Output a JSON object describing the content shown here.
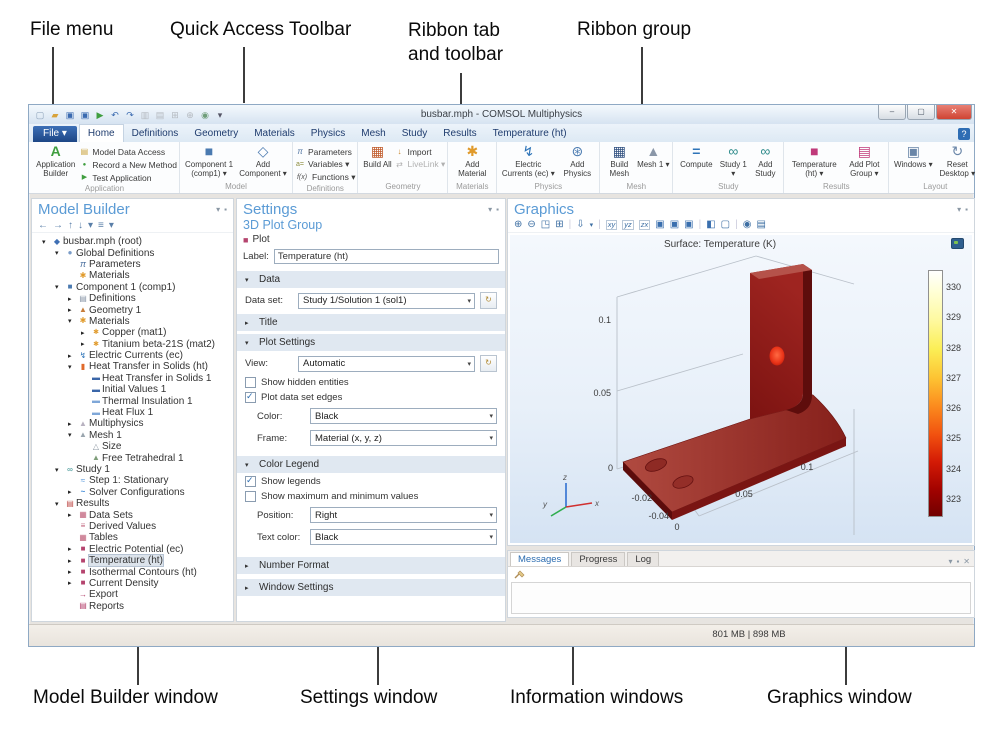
{
  "annotations": {
    "file_menu": "File menu",
    "quick_access": "Quick Access Toolbar",
    "ribbon_tab": "Ribbon tab and toolbar",
    "ribbon_group": "Ribbon group",
    "model_builder": "Model Builder window",
    "settings": "Settings window",
    "information": "Information windows",
    "graphics": "Graphics window"
  },
  "window": {
    "title": "busbar.mph - COMSOL Multiphysics",
    "file_button": "File ▾",
    "minimize_icon": "–",
    "maximize_icon": "▢",
    "close_icon": "✕",
    "help_icon": "?",
    "tabs": [
      {
        "label": "Home",
        "cls": "active",
        "name": "tab-home"
      },
      {
        "label": "Definitions",
        "name": "tab-definitions"
      },
      {
        "label": "Geometry",
        "name": "tab-geometry"
      },
      {
        "label": "Materials",
        "name": "tab-materials"
      },
      {
        "label": "Physics",
        "name": "tab-physics"
      },
      {
        "label": "Mesh",
        "name": "tab-mesh"
      },
      {
        "label": "Study",
        "name": "tab-study"
      },
      {
        "label": "Results",
        "name": "tab-results"
      },
      {
        "label": "Temperature (ht)",
        "name": "tab-temperature-ht"
      }
    ],
    "qat": [
      {
        "name": "new-file-icon",
        "glyph": "▢",
        "cls": "c-mid"
      },
      {
        "name": "open-file-icon",
        "glyph": "▰",
        "cls": "c-amber"
      },
      {
        "name": "save-icon",
        "glyph": "▣",
        "cls": "c-blue"
      },
      {
        "name": "save-as-icon",
        "glyph": "▣",
        "cls": "c-blue"
      },
      {
        "name": "run-icon",
        "glyph": "▶",
        "cls": "c-green"
      },
      {
        "name": "undo-icon",
        "glyph": "↶",
        "cls": "c-blue"
      },
      {
        "name": "redo-icon",
        "glyph": "↷",
        "cls": "c-blue"
      },
      {
        "name": "copy-icon",
        "glyph": "▥",
        "cls": "c-gray"
      },
      {
        "name": "paste-icon",
        "glyph": "▤",
        "cls": "c-gray"
      },
      {
        "name": "insert-icon",
        "glyph": "⊞",
        "cls": "c-gray"
      },
      {
        "name": "zoom-icon",
        "glyph": "⊕",
        "cls": "c-gray"
      },
      {
        "name": "options-icon",
        "glyph": "◉",
        "cls": "c-teal"
      },
      {
        "name": "qat-dropdown-icon",
        "glyph": "▾",
        "cls": "c-dark"
      }
    ]
  },
  "ribbon": {
    "groups": [
      {
        "label": "Application",
        "big": [
          {
            "label": "Application Builder"
          }
        ],
        "small": [
          {
            "label": "Model Data Access"
          },
          {
            "label": "Record a New Method"
          },
          {
            "label": "Test Application"
          }
        ]
      },
      {
        "label": "Model",
        "big": [
          {
            "label": "Component 1 (comp1) ▾"
          },
          {
            "label": "Add Component ▾"
          }
        ]
      },
      {
        "label": "Definitions",
        "small": [
          {
            "label": "Parameters"
          },
          {
            "label": "Variables ▾"
          },
          {
            "label": "Functions ▾"
          }
        ]
      },
      {
        "label": "Geometry",
        "big": [
          {
            "label": "Build All"
          }
        ],
        "small": [
          {
            "label": "Import"
          },
          {
            "label": "LiveLink ▾"
          }
        ]
      },
      {
        "label": "Materials",
        "big": [
          {
            "label": "Add Material"
          }
        ]
      },
      {
        "label": "Physics",
        "big": [
          {
            "label": "Electric Currents (ec) ▾"
          },
          {
            "label": "Add Physics"
          }
        ]
      },
      {
        "label": "Mesh",
        "big": [
          {
            "label": "Build Mesh"
          },
          {
            "label": "Mesh 1 ▾"
          }
        ]
      },
      {
        "label": "Study",
        "big": [
          {
            "label": "Compute"
          },
          {
            "label": "Study 1 ▾"
          },
          {
            "label": "Add Study"
          }
        ]
      },
      {
        "label": "Results",
        "big": [
          {
            "label": "Temperature (ht) ▾"
          },
          {
            "label": "Add Plot Group ▾"
          }
        ]
      },
      {
        "label": "Layout",
        "big": [
          {
            "label": "Windows ▾"
          },
          {
            "label": "Reset Desktop ▾"
          }
        ]
      }
    ]
  },
  "model_builder": {
    "title": "Model Builder",
    "toolbar": [
      {
        "name": "back-icon",
        "glyph": "←"
      },
      {
        "name": "forward-icon",
        "glyph": "→"
      },
      {
        "name": "move-up-icon",
        "glyph": "↑"
      },
      {
        "name": "move-down-icon",
        "glyph": "↓"
      },
      {
        "name": "show-options-icon",
        "glyph": "▾"
      },
      {
        "name": "collapse-all-icon",
        "glyph": "≡"
      },
      {
        "name": "toolbar-more-icon",
        "glyph": "▾"
      }
    ],
    "tree": [
      {
        "label": "busbar.mph (root)",
        "cls": "d0",
        "arrow": "exp",
        "icon": "i-model"
      },
      {
        "label": "Global Definitions",
        "cls": "d1",
        "arrow": "exp",
        "icon": "i-global"
      },
      {
        "label": "Parameters",
        "cls": "d2",
        "arrow": "leaf",
        "icon": "i-parameters"
      },
      {
        "label": "Materials",
        "cls": "d2",
        "arrow": "leaf",
        "icon": "i-materials"
      },
      {
        "label": "Component 1 (comp1)",
        "cls": "d1",
        "arrow": "exp",
        "icon": "i-component"
      },
      {
        "label": "Definitions",
        "cls": "d2",
        "arrow": "col",
        "icon": "i-definitions"
      },
      {
        "label": "Geometry 1",
        "cls": "d2",
        "arrow": "col",
        "icon": "i-geometry"
      },
      {
        "label": "Materials",
        "cls": "d2",
        "arrow": "exp",
        "icon": "i-materials"
      },
      {
        "label": "Copper (mat1)",
        "cls": "d3",
        "arrow": "col",
        "icon": "i-material"
      },
      {
        "label": "Titanium beta-21S (mat2)",
        "cls": "d3",
        "arrow": "col",
        "icon": "i-material"
      },
      {
        "label": "Electric Currents (ec)",
        "cls": "d2",
        "arrow": "col",
        "icon": "i-ec"
      },
      {
        "label": "Heat Transfer in Solids (ht)",
        "cls": "d2",
        "arrow": "exp",
        "icon": "i-ht"
      },
      {
        "label": "Heat Transfer in Solids 1",
        "cls": "d3",
        "arrow": "leaf",
        "icon": "i-htdom"
      },
      {
        "label": "Initial Values 1",
        "cls": "d3",
        "arrow": "leaf",
        "icon": "i-htdom"
      },
      {
        "label": "Thermal Insulation 1",
        "cls": "d3",
        "arrow": "leaf",
        "icon": "i-htbnd"
      },
      {
        "label": "Heat Flux 1",
        "cls": "d3",
        "arrow": "leaf",
        "icon": "i-htbnd"
      },
      {
        "label": "Multiphysics",
        "cls": "d2",
        "arrow": "col",
        "icon": "i-multi"
      },
      {
        "label": "Mesh 1",
        "cls": "d2",
        "arrow": "exp",
        "icon": "i-mesh"
      },
      {
        "label": "Size",
        "cls": "d3",
        "arrow": "leaf",
        "icon": "i-size"
      },
      {
        "label": "Free Tetrahedral 1",
        "cls": "d3",
        "arrow": "leaf",
        "icon": "i-tet"
      },
      {
        "label": "Study 1",
        "cls": "d1",
        "arrow": "exp",
        "icon": "i-study"
      },
      {
        "label": "Step 1: Stationary",
        "cls": "d2",
        "arrow": "leaf",
        "icon": "i-step"
      },
      {
        "label": "Solver Configurations",
        "cls": "d2",
        "arrow": "col",
        "icon": "i-solver"
      },
      {
        "label": "Results",
        "cls": "d1",
        "arrow": "exp",
        "icon": "i-results"
      },
      {
        "label": "Data Sets",
        "cls": "d2",
        "arrow": "col",
        "icon": "i-datasets"
      },
      {
        "label": "Derived Values",
        "cls": "d2",
        "arrow": "leaf",
        "icon": "i-derived"
      },
      {
        "label": "Tables",
        "cls": "d2",
        "arrow": "leaf",
        "icon": "i-tables"
      },
      {
        "label": "Electric Potential (ec)",
        "cls": "d2",
        "arrow": "col",
        "icon": "i-plot3d"
      },
      {
        "label": "Temperature (ht)",
        "cls": "d2 sel",
        "arrow": "col",
        "icon": "i-plot3d"
      },
      {
        "label": "Isothermal Contours (ht)",
        "cls": "d2",
        "arrow": "col",
        "icon": "i-plot3d"
      },
      {
        "label": "Current Density",
        "cls": "d2",
        "arrow": "col",
        "icon": "i-plot3d"
      },
      {
        "label": "Export",
        "cls": "d2",
        "arrow": "leaf",
        "icon": "i-export"
      },
      {
        "label": "Reports",
        "cls": "d2",
        "arrow": "leaf",
        "icon": "i-reports"
      }
    ]
  },
  "settings": {
    "title": "Settings",
    "type": "3D Plot Group",
    "plot_button": "Plot",
    "label_caption": "Label:",
    "label_value": "Temperature (ht)",
    "data_title": "Data",
    "dataset_caption": "Data set:",
    "dataset_value": "Study 1/Solution 1 (sol1)",
    "title_title": "Title",
    "plot_settings_title": "Plot Settings",
    "view_caption": "View:",
    "view_value": "Automatic",
    "show_hidden": "Show hidden entities",
    "plot_edges": "Plot data set edges",
    "color_caption": "Color:",
    "color_value": "Black",
    "frame_caption": "Frame:",
    "frame_value": "Material  (x, y, z)",
    "color_legend_title": "Color Legend",
    "show_legends": "Show legends",
    "show_maxmin": "Show maximum and minimum values",
    "position_caption": "Position:",
    "position_value": "Right",
    "textcolor_caption": "Text color:",
    "textcolor_value": "Black",
    "number_format_title": "Number Format",
    "window_settings_title": "Window Settings"
  },
  "graphics": {
    "title": "Graphics",
    "plot_title": "Surface: Temperature (K)",
    "legend_values": [
      "330",
      "329",
      "328",
      "327",
      "326",
      "325",
      "324",
      "323"
    ],
    "axis": {
      "left": [
        "0.1",
        "0.05",
        "0"
      ],
      "bottom_y": [
        "-0.02",
        "-0.04"
      ],
      "bottom_x": [
        "0",
        "0.05",
        "0.1"
      ]
    },
    "triad": {
      "x": "x",
      "y": "y",
      "z": "z"
    },
    "toolbar": [
      {
        "name": "zoom-in-icon",
        "glyph": "⊕"
      },
      {
        "name": "zoom-out-icon",
        "glyph": "⊖"
      },
      {
        "name": "zoom-extents-icon",
        "glyph": "◳"
      },
      {
        "name": "zoom-box-icon",
        "glyph": "⊞"
      },
      {
        "name": "separator",
        "glyph": "|",
        "cls": "sep"
      },
      {
        "name": "default-view-icon",
        "glyph": "⇩"
      },
      {
        "name": "view-menu-icon",
        "glyph": "▾",
        "cls": "tiny"
      },
      {
        "name": "separator",
        "glyph": "|",
        "cls": "sep"
      },
      {
        "name": "view-xy-icon",
        "glyph": "xy",
        "cls": "txt"
      },
      {
        "name": "view-yz-icon",
        "glyph": "yz",
        "cls": "txt"
      },
      {
        "name": "view-zx-icon",
        "glyph": "zx",
        "cls": "txt"
      },
      {
        "name": "orthographic-icon",
        "glyph": "▣",
        "cls": "c-blue2"
      },
      {
        "name": "perspective-icon",
        "glyph": "▣",
        "cls": "c-blue2"
      },
      {
        "name": "scene-light-icon",
        "glyph": "▣",
        "cls": "c-blue2"
      },
      {
        "name": "separator",
        "glyph": "|",
        "cls": "sep"
      },
      {
        "name": "select-box-icon",
        "glyph": "◧",
        "cls": "c-blue2"
      },
      {
        "name": "transparency-icon",
        "glyph": "▢"
      },
      {
        "name": "separator",
        "glyph": "|",
        "cls": "sep"
      },
      {
        "name": "snapshot-icon",
        "glyph": "◉"
      },
      {
        "name": "print-icon",
        "glyph": "▤"
      }
    ]
  },
  "info": {
    "tabs": [
      {
        "label": "Messages",
        "cls": "active",
        "name": "tab-messages"
      },
      {
        "label": "Progress",
        "name": "tab-progress"
      },
      {
        "label": "Log",
        "name": "tab-log"
      }
    ]
  },
  "status": {
    "memory": "801 MB | 898 MB"
  }
}
